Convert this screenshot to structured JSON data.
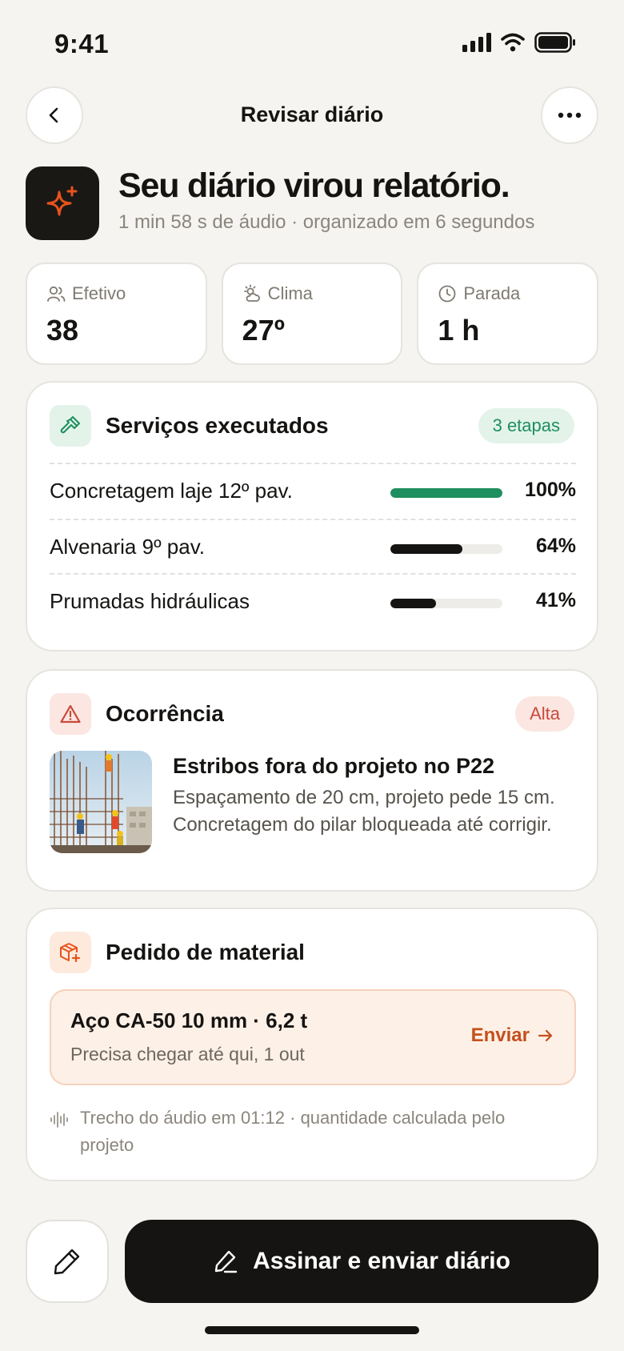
{
  "status": {
    "time": "9:41"
  },
  "header": {
    "title": "Revisar diário"
  },
  "hero": {
    "title": "Seu diário virou relatório.",
    "subtitle": "1 min 58 s de áudio · organizado em 6 segundos"
  },
  "stats": [
    {
      "label": "Efetivo",
      "value": "38",
      "icon": "users-icon"
    },
    {
      "label": "Clima",
      "value": "27º",
      "icon": "sun-cloud-icon"
    },
    {
      "label": "Parada",
      "value": "1 h",
      "icon": "clock-icon"
    }
  ],
  "services": {
    "title": "Serviços executados",
    "badge": "3 etapas",
    "items": [
      {
        "name": "Concretagem laje 12º pav.",
        "progress": 100,
        "label": "100%",
        "color": "#1e8f5e"
      },
      {
        "name": "Alvenaria 9º pav.",
        "progress": 64,
        "label": "64%",
        "color": "#151412"
      },
      {
        "name": "Prumadas hidráulicas",
        "progress": 41,
        "label": "41%",
        "color": "#151412"
      }
    ]
  },
  "occurrence": {
    "title": "Ocorrência",
    "badge": "Alta",
    "item_title": "Estribos fora do projeto no P22",
    "item_desc": "Espaçamento de 20 cm, projeto pede 15 cm. Concretagem do pilar bloqueada até corrigir."
  },
  "material": {
    "title": "Pedido de material",
    "item_title": "Aço CA-50 10 mm · 6,2 t",
    "item_sub": "Precisa chegar até qui, 1 out",
    "send_label": "Enviar",
    "note": "Trecho do áudio em 01:12 · quantidade calculada pelo projeto"
  },
  "actions": {
    "sign_label": "Assinar e enviar diário"
  },
  "colors": {
    "accent": "#e8531b",
    "success": "#1e8f5e",
    "danger": "#c94a3a",
    "dark": "#151412"
  }
}
